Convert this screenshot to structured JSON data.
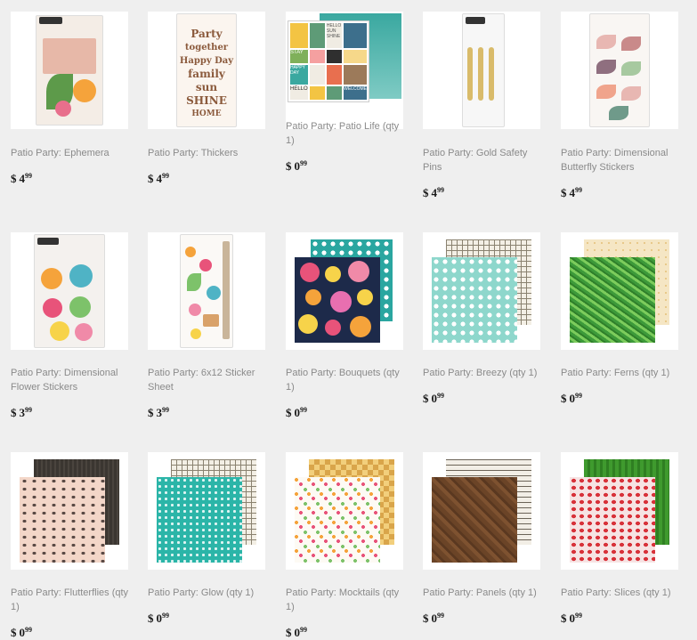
{
  "currency_symbol": "$",
  "products": [
    {
      "name": "Patio Party: Ephemera",
      "price_whole": "4",
      "price_cents": "99"
    },
    {
      "name": "Patio Party: Thickers",
      "price_whole": "4",
      "price_cents": "99"
    },
    {
      "name": "Patio Party: Patio Life (qty 1)",
      "price_whole": "0",
      "price_cents": "99"
    },
    {
      "name": "Patio Party: Gold Safety Pins",
      "price_whole": "4",
      "price_cents": "99"
    },
    {
      "name": "Patio Party: Dimensional Butterfly Stickers",
      "price_whole": "4",
      "price_cents": "99"
    },
    {
      "name": "Patio Party: Dimensional Flower Stickers",
      "price_whole": "3",
      "price_cents": "99"
    },
    {
      "name": "Patio Party: 6x12 Sticker Sheet",
      "price_whole": "3",
      "price_cents": "99"
    },
    {
      "name": "Patio Party: Bouquets (qty 1)",
      "price_whole": "0",
      "price_cents": "99"
    },
    {
      "name": "Patio Party: Breezy (qty 1)",
      "price_whole": "0",
      "price_cents": "99"
    },
    {
      "name": "Patio Party: Ferns (qty 1)",
      "price_whole": "0",
      "price_cents": "99"
    },
    {
      "name": "Patio Party: Flutterflies (qty 1)",
      "price_whole": "0",
      "price_cents": "99"
    },
    {
      "name": "Patio Party: Glow (qty 1)",
      "price_whole": "0",
      "price_cents": "99"
    },
    {
      "name": "Patio Party: Mocktails (qty 1)",
      "price_whole": "0",
      "price_cents": "99"
    },
    {
      "name": "Patio Party: Panels (qty 1)",
      "price_whole": "0",
      "price_cents": "99"
    },
    {
      "name": "Patio Party: Slices (qty 1)",
      "price_whole": "0",
      "price_cents": "99"
    }
  ],
  "artwork": {
    "thickers_words": [
      "Party",
      "together",
      "Happy Day",
      "family",
      "sun",
      "SHINE",
      "HOME"
    ],
    "patio_life_words": [
      "HELLO SUN SHINE",
      "STAY",
      "HAPPY DAY",
      "HELLO",
      "WELCOME"
    ]
  }
}
